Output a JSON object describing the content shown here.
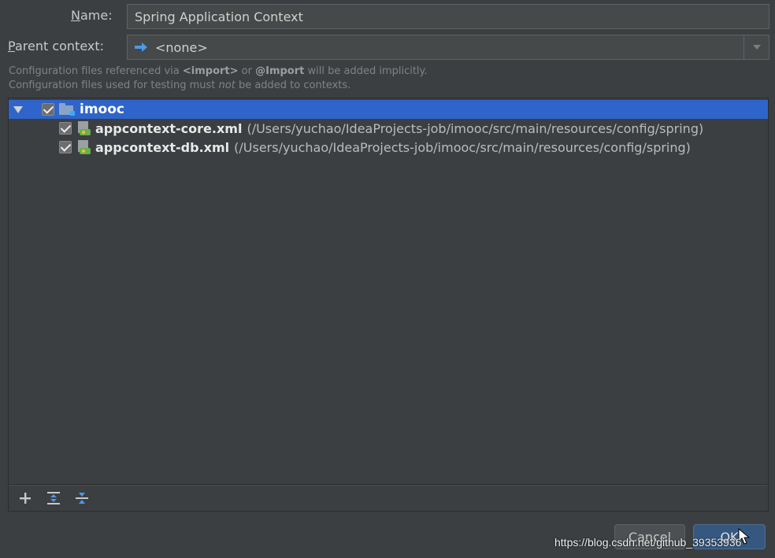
{
  "form": {
    "name_label_u": "N",
    "name_label_rest": "ame:",
    "name_value": "Spring Application Context",
    "parent_label_u": "P",
    "parent_label_rest": "arent context:",
    "parent_value": "<none>"
  },
  "hints": {
    "line1_a": "Configuration files referenced via ",
    "line1_b": "<import>",
    "line1_c": " or ",
    "line1_d": "@Import",
    "line1_e": " will be added implicitly.",
    "line2_a": "Configuration files used for testing must ",
    "line2_b": "not",
    "line2_c": " be added to contexts."
  },
  "tree": {
    "root": {
      "label": "imooc",
      "checked": true,
      "expanded": true
    },
    "items": [
      {
        "file": "appcontext-core.xml",
        "path": "(/Users/yuchao/IdeaProjects-job/imooc/src/main/resources/config/spring)",
        "checked": true
      },
      {
        "file": "appcontext-db.xml",
        "path": "(/Users/yuchao/IdeaProjects-job/imooc/src/main/resources/config/spring)",
        "checked": true
      }
    ]
  },
  "toolbar": {
    "add_icon": "plus-icon",
    "expand_icon": "expand-all-icon",
    "collapse_icon": "collapse-all-icon"
  },
  "buttons": {
    "cancel": "Cancel",
    "ok": "OK"
  },
  "watermark": "https://blog.csdn.net/github_39353936",
  "colors": {
    "background": "#3c3f41",
    "selection": "#2f65ca",
    "ok_button": "#365880",
    "arrow_icon": "#4a9be8"
  }
}
